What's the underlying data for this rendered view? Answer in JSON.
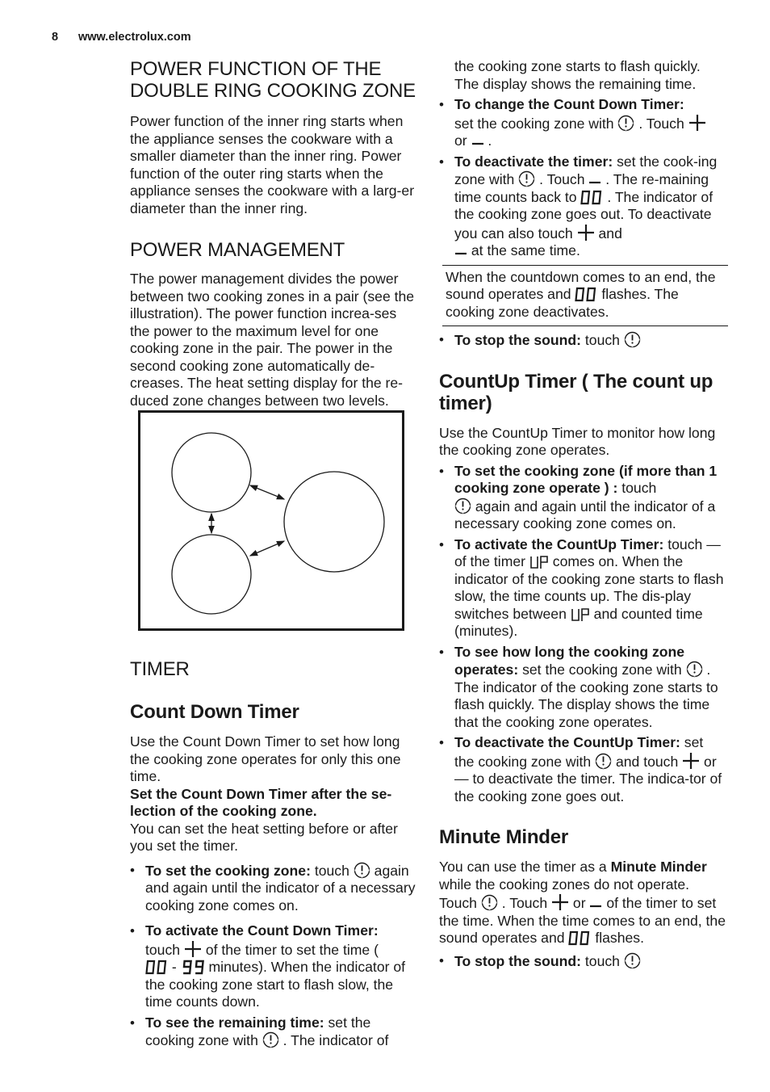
{
  "header": {
    "page_number": "8",
    "site": "www.electrolux.com"
  },
  "left": {
    "double_ring": {
      "title_line1": "POWER FUNCTION OF THE",
      "title_line2": "DOUBLE RING COOKING ZONE",
      "body": "Power function of the inner ring starts when the appliance senses the cookware with a smaller diameter than the inner ring. Power function of the outer ring starts when the appliance senses the cookware with a larg-er diameter than the inner ring."
    },
    "power_management": {
      "title": "POWER MANAGEMENT",
      "body": "The power management divides the power between two cooking zones in a pair (see the illustration). The power function increa-ses the power to the maximum level for one cooking zone in the pair. The power in the second cooking zone automatically de-creases. The heat setting display for the re-duced zone changes between two levels."
    },
    "timer": {
      "title": "TIMER",
      "countdown_title": "Count Down Timer",
      "intro": "Use the Count Down Timer to set how long the cooking zone operates for only this one time.",
      "bold_note": "Set the Count Down Timer after the se-lection of the cooking zone.",
      "heat_note": "You can set the heat setting before or after you set the timer.",
      "bullet1_bold": "To set the cooking zone:",
      "bullet1_a": " touch ",
      "bullet1_b": " again and again until the indicator of a necessary cooking zone comes on.",
      "bullet2_bold": "To activate the Count Down Timer:",
      "bullet2_a": "touch ",
      "bullet2_b": " of the timer to set the time ( ",
      "bullet2_dash": " - ",
      "bullet2_c": " minutes). When the indicator of the cooking zone start to flash slow, the time counts down.",
      "bullet3_bold": "To see the remaining time:",
      "bullet3_a": " set the cooking zone with ",
      "bullet3_b": " . The indicator of"
    }
  },
  "right": {
    "cont": "the cooking zone starts to flash quickly. The display shows the remaining time.",
    "change_bold": "To change the Count Down Timer:",
    "change_a": "set the cooking zone with ",
    "change_b": " . Touch ",
    "change_c": "or ",
    "change_d": " .",
    "deact_bold": "To deactivate the timer:",
    "deact_a": " set the cook-ing zone with ",
    "deact_b": " . Touch ",
    "deact_c": " . The re-maining time counts back to ",
    "deact_d": " . The indicator of the cooking zone goes out. To deactivate you can also touch ",
    "deact_e": " and ",
    "deact_f": " at the same time.",
    "note_a": "When the countdown comes to an end, the sound operates and ",
    "note_b": " flashes. The cooking zone deactivates.",
    "stop_bold": "To stop the sound:",
    "stop_a": " touch ",
    "countup": {
      "title": "CountUp Timer ( The count up timer)",
      "intro": "Use the CountUp Timer to monitor how long the cooking zone operates.",
      "b1_bold": "To set the cooking zone (if more than 1 cooking zone operate ) :",
      "b1_a": " touch ",
      "b1_b": " again and again until the indicator of a necessary cooking zone comes on.",
      "b2_bold": "To activate the CountUp Timer:",
      "b2_a": " touch — of the timer ",
      "b2_b": " comes on. When the indicator of the cooking zone starts to flash slow, the time counts up. The dis-play switches between ",
      "b2_c": " and counted time (minutes).",
      "b3_bold": "To see how long the cooking zone operates:",
      "b3_a": " set the cooking zone with ",
      "b3_b": " . The indicator of the cooking zone starts to flash quickly. The display shows the time that the cooking zone operates.",
      "b4_bold": "To deactivate the CountUp Timer:",
      "b4_a": " set the cooking zone with ",
      "b4_b": " and touch ",
      "b4_c": " or — to deactivate the timer. The indica-tor of the cooking zone goes out."
    },
    "minute": {
      "title": "Minute Minder",
      "p_a": "You can use the timer as a ",
      "p_bold": "Minute Minder",
      "p_b": " while the cooking zones do not operate. Touch ",
      "p_c": " . Touch ",
      "p_d": " or ",
      "p_e": " of the timer to set the time. When the time comes to an end, the sound operates and ",
      "p_f": " flashes.",
      "stop_bold": "To stop the sound:",
      "stop_a": " touch "
    }
  },
  "icons": {
    "timer": "timer-icon",
    "plus": "plus-icon",
    "minus": "minus-icon",
    "display_00": "display-00-icon",
    "display_99": "display-99-icon",
    "display_up": "display-up-icon"
  }
}
